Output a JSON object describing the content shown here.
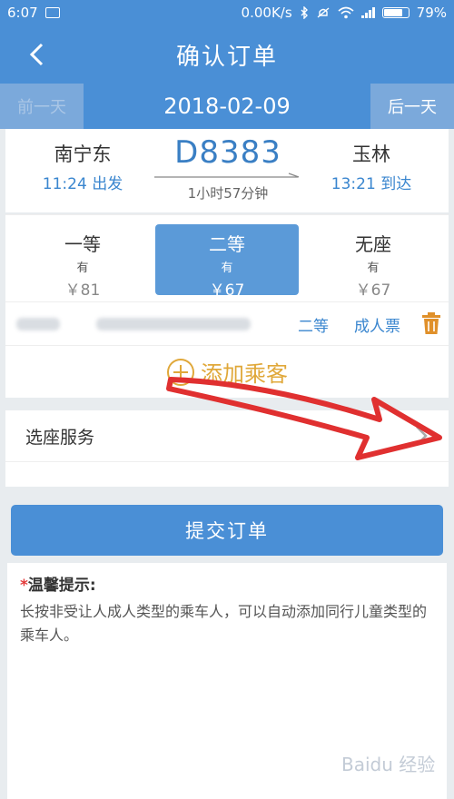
{
  "status_bar": {
    "time": "6:07",
    "speed": "0.00K/s",
    "battery": "79%",
    "battery_level": 0.79
  },
  "header": {
    "title": "确认订单"
  },
  "date_bar": {
    "prev_label": "前一天",
    "date": "2018-02-09",
    "next_label": "后一天"
  },
  "train": {
    "from_station": "南宁东",
    "depart_time": "11:24 出发",
    "number": "D8383",
    "duration": "1小时57分钟",
    "to_station": "玉林",
    "arrive_time": "13:21 到达"
  },
  "seats": [
    {
      "type": "一等",
      "availability": "有",
      "price": "￥81",
      "selected": false
    },
    {
      "type": "二等",
      "availability": "有",
      "price": "￥67",
      "selected": true
    },
    {
      "type": "无座",
      "availability": "有",
      "price": "￥67",
      "selected": false
    }
  ],
  "passenger": {
    "seat_class": "二等",
    "ticket_type": "成人票"
  },
  "add_passenger": {
    "label": "添加乘客"
  },
  "seat_service": {
    "label": "选座服务"
  },
  "submit": {
    "label": "提交订单"
  },
  "tip": {
    "star": "*",
    "title": "温馨提示:",
    "body": "长按非受让人成人类型的乘车人，可以自动添加同行儿童类型的乘车人。"
  },
  "watermark": {
    "text": "Baidu 经验"
  },
  "colors": {
    "primary": "#4a8fd6",
    "accent": "#3a86cf",
    "add": "#e0a83a",
    "annotation_arrow": "#e03030"
  }
}
